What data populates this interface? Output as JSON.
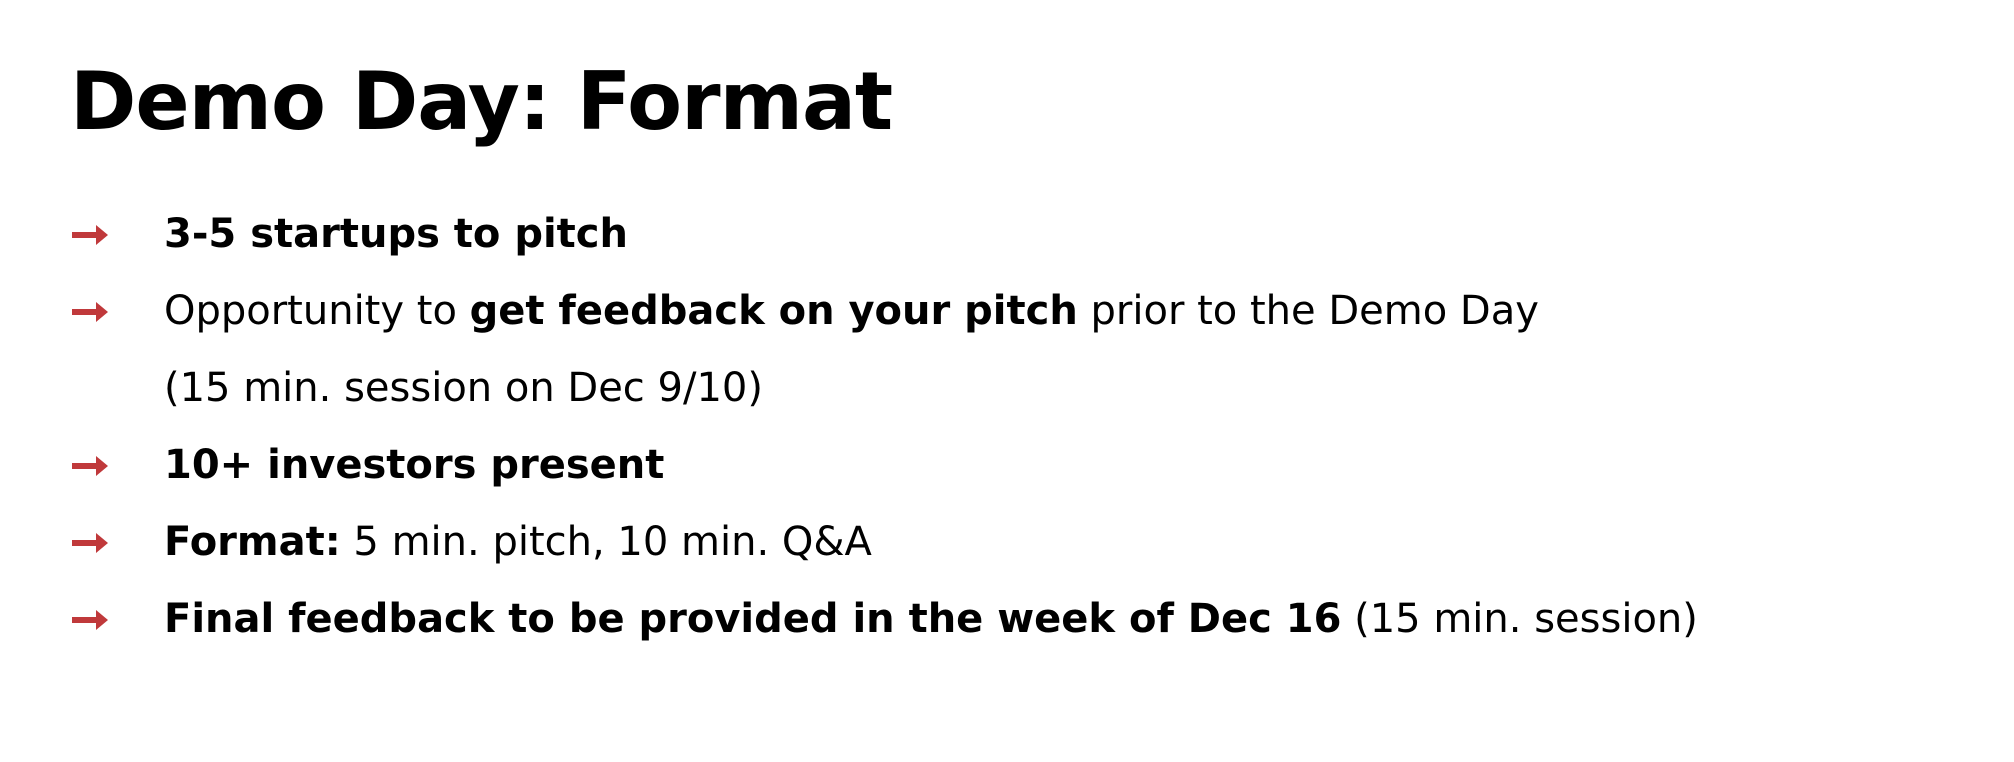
{
  "slide": {
    "title": "Demo Day: Format",
    "accent_color": "#c0393b",
    "bullet_icon": "arrow-right-icon",
    "bullets": [
      {
        "bold": "3-5 startups to pitch"
      },
      {
        "lead": "Opportunity to ",
        "bold": "get feedback on your pitch",
        "tail": " prior to the Demo Day",
        "line2": "(15 min. session on Dec 9/10)"
      },
      {
        "bold": "10+ investors present"
      },
      {
        "bold": "Format:",
        "tail": " 5 min. pitch, 10 min. Q&A"
      },
      {
        "bold": "Final feedback to be provided in the week of Dec 16",
        "tail": " (15 min. session)"
      }
    ]
  }
}
